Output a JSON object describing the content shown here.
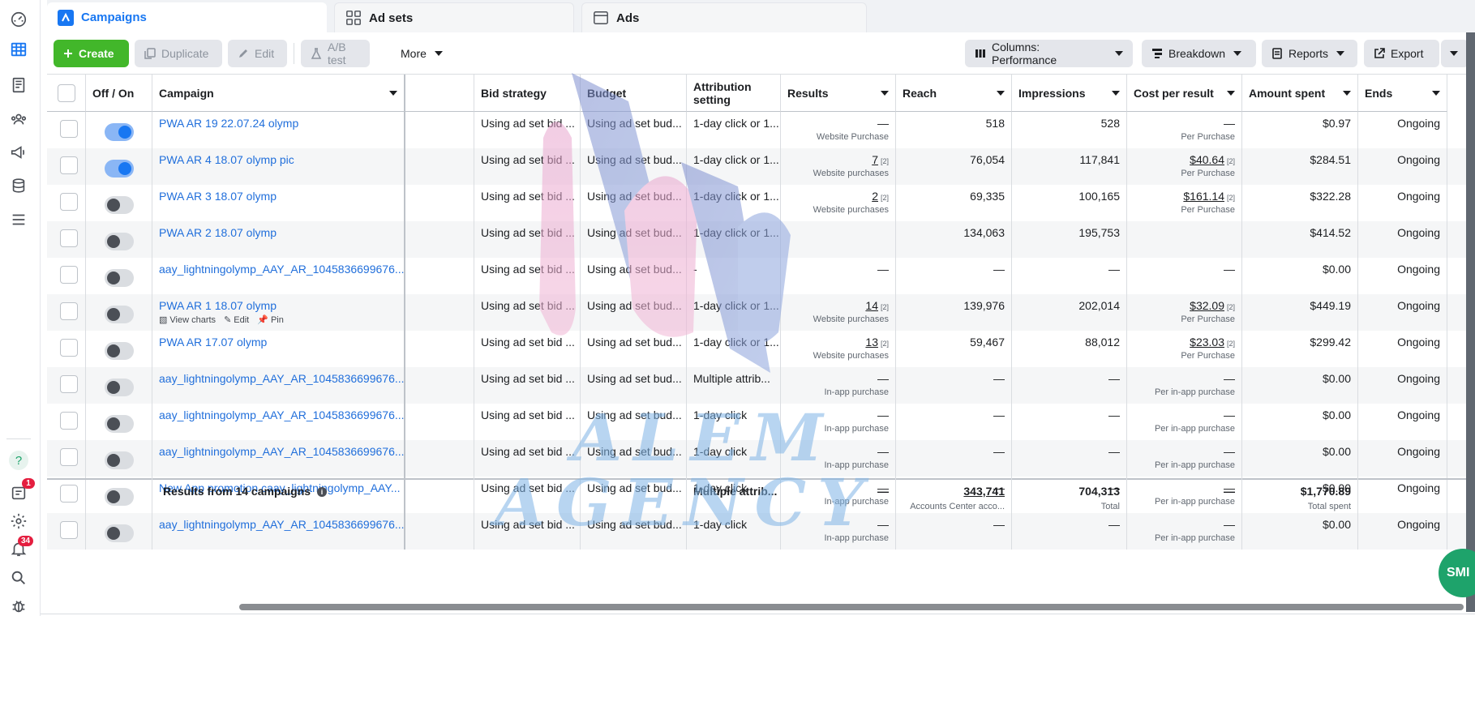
{
  "tabs": [
    {
      "label": "Campaigns",
      "icon": "campaigns-icon",
      "active": true
    },
    {
      "label": "Ad sets",
      "icon": "adsets-grid-icon",
      "active": false
    },
    {
      "label": "Ads",
      "icon": "ads-card-icon",
      "active": false
    }
  ],
  "toolbar": {
    "create": "Create",
    "duplicate": "Duplicate",
    "edit": "Edit",
    "ab_test": "A/B test",
    "more": "More",
    "columns": "Columns: Performance",
    "breakdown": "Breakdown",
    "reports": "Reports",
    "export": "Export"
  },
  "columns": {
    "off_on": "Off / On",
    "campaign": "Campaign",
    "bid_strategy": "Bid strategy",
    "budget": "Budget",
    "attribution_1": "Attribution",
    "attribution_2": "setting",
    "results": "Results",
    "reach": "Reach",
    "impressions": "Impressions",
    "cost_per_result": "Cost per result",
    "amount_spent": "Amount spent",
    "ends": "Ends"
  },
  "rows": [
    {
      "on": true,
      "name": "PWA AR 19 22.07.24 olymp",
      "bid": "Using ad set bid ...",
      "budget": "Using ad set bud...",
      "attr": "1-day click or 1...",
      "results": "—",
      "results_sub": "Website Purchase",
      "results_sup": "",
      "reach": "518",
      "impr": "528",
      "cpr": "—",
      "cpr_sub": "Per Purchase",
      "cpr_sup": "",
      "spent": "$0.97",
      "ends": "Ongoing"
    },
    {
      "on": true,
      "name": "PWA AR 4 18.07 olymp pic",
      "bid": "Using ad set bid ...",
      "budget": "Using ad set bud...",
      "attr": "1-day click or 1...",
      "results": "7",
      "results_sub": "Website purchases",
      "results_sup": "[2]",
      "reach": "76,054",
      "impr": "117,841",
      "cpr": "$40.64",
      "cpr_sub": "Per Purchase",
      "cpr_sup": "[2]",
      "spent": "$284.51",
      "ends": "Ongoing"
    },
    {
      "on": false,
      "name": "PWA AR 3 18.07 olymp",
      "bid": "Using ad set bid ...",
      "budget": "Using ad set bud...",
      "attr": "1-day click or 1...",
      "results": "2",
      "results_sub": "Website purchases",
      "results_sup": "[2]",
      "reach": "69,335",
      "impr": "100,165",
      "cpr": "$161.14",
      "cpr_sub": "Per Purchase",
      "cpr_sup": "[2]",
      "spent": "$322.28",
      "ends": "Ongoing"
    },
    {
      "on": false,
      "name": "PWA AR 2 18.07 olymp",
      "bid": "Using ad set bid ...",
      "budget": "Using ad set bud...",
      "attr": "1-day click or 1...",
      "results": "",
      "results_sub": "",
      "results_sup": "",
      "reach": "134,063",
      "impr": "195,753",
      "cpr": "",
      "cpr_sub": "",
      "cpr_sup": "",
      "spent": "$414.52",
      "ends": "Ongoing"
    },
    {
      "on": false,
      "name": "aay_lightningolymp_AAY_AR_1045836699676...",
      "bid": "Using ad set bid ...",
      "budget": "Using ad set bud...",
      "attr": "-",
      "results": "—",
      "results_sub": "",
      "results_sup": "",
      "reach": "—",
      "impr": "—",
      "cpr": "—",
      "cpr_sub": "",
      "cpr_sup": "",
      "spent": "$0.00",
      "ends": "Ongoing"
    },
    {
      "on": false,
      "name": "PWA AR 1 18.07 olymp",
      "bid": "Using ad set bid ...",
      "budget": "Using ad set bud...",
      "attr": "1-day click or 1...",
      "results": "14",
      "results_sub": "Website purchases",
      "results_sup": "[2]",
      "reach": "139,976",
      "impr": "202,014",
      "cpr": "$32.09",
      "cpr_sub": "Per Purchase",
      "cpr_sup": "[2]",
      "spent": "$449.19",
      "ends": "Ongoing",
      "actions": [
        "View charts",
        "Edit",
        "Pin"
      ]
    },
    {
      "on": false,
      "name": "PWA AR 17.07 olymp",
      "bid": "Using ad set bid ...",
      "budget": "Using ad set bud...",
      "attr": "1-day click or 1...",
      "results": "13",
      "results_sub": "Website purchases",
      "results_sup": "[2]",
      "reach": "59,467",
      "impr": "88,012",
      "cpr": "$23.03",
      "cpr_sub": "Per Purchase",
      "cpr_sup": "[2]",
      "spent": "$299.42",
      "ends": "Ongoing"
    },
    {
      "on": false,
      "name": "aay_lightningolymp_AAY_AR_1045836699676...",
      "bid": "Using ad set bid ...",
      "budget": "Using ad set bud...",
      "attr": "Multiple attrib...",
      "results": "—",
      "results_sub": "In-app purchase",
      "results_sup": "",
      "reach": "—",
      "impr": "—",
      "cpr": "—",
      "cpr_sub": "Per in-app purchase",
      "cpr_sup": "",
      "spent": "$0.00",
      "ends": "Ongoing"
    },
    {
      "on": false,
      "name": "aay_lightningolymp_AAY_AR_1045836699676...",
      "bid": "Using ad set bid ...",
      "budget": "Using ad set bud...",
      "attr": "1-day click",
      "results": "—",
      "results_sub": "In-app purchase",
      "results_sup": "",
      "reach": "—",
      "impr": "—",
      "cpr": "—",
      "cpr_sub": "Per in-app purchase",
      "cpr_sup": "",
      "spent": "$0.00",
      "ends": "Ongoing"
    },
    {
      "on": false,
      "name": "aay_lightningolymp_AAY_AR_1045836699676...",
      "bid": "Using ad set bid ...",
      "budget": "Using ad set bud...",
      "attr": "1-day click",
      "results": "—",
      "results_sub": "In-app purchase",
      "results_sup": "",
      "reach": "—",
      "impr": "—",
      "cpr": "—",
      "cpr_sub": "Per in-app purchase",
      "cpr_sup": "",
      "spent": "$0.00",
      "ends": "Ongoing"
    },
    {
      "on": false,
      "name": "New App promotion caay_lightningolymp_AAY...",
      "bid": "Using ad set bid ...",
      "budget": "Using ad set bud...",
      "attr": "1-day click",
      "results": "—",
      "results_sub": "In-app purchase",
      "results_sup": "",
      "reach": "—",
      "impr": "—",
      "cpr": "—",
      "cpr_sub": "Per in-app purchase",
      "cpr_sup": "",
      "spent": "$0.00",
      "ends": "Ongoing"
    },
    {
      "on": false,
      "name": "aay_lightningolymp_AAY_AR_1045836699676...",
      "bid": "Using ad set bid ...",
      "budget": "Using ad set bud...",
      "attr": "1-day click",
      "results": "—",
      "results_sub": "In-app purchase",
      "results_sup": "",
      "reach": "—",
      "impr": "—",
      "cpr": "—",
      "cpr_sub": "Per in-app purchase",
      "cpr_sup": "",
      "spent": "$0.00",
      "ends": "Ongoing"
    }
  ],
  "footer": {
    "label": "Results from 14 campaigns",
    "attr": "Multiple attrib...",
    "results": "—",
    "reach": "343,741",
    "reach_sub": "Accounts Center acco...",
    "impr": "704,313",
    "impr_sub": "Total",
    "cpr": "—",
    "spent": "$1,770.89",
    "spent_sub": "Total spent"
  },
  "rail": {
    "badge_1": "1",
    "badge_34": "34"
  },
  "watermark": {
    "line1": "ALEM",
    "line2": "AGENCY"
  },
  "chat_label": "SMI",
  "colors": {
    "accent": "#1877f2",
    "create": "#42b72a",
    "link": "#216fdb"
  }
}
